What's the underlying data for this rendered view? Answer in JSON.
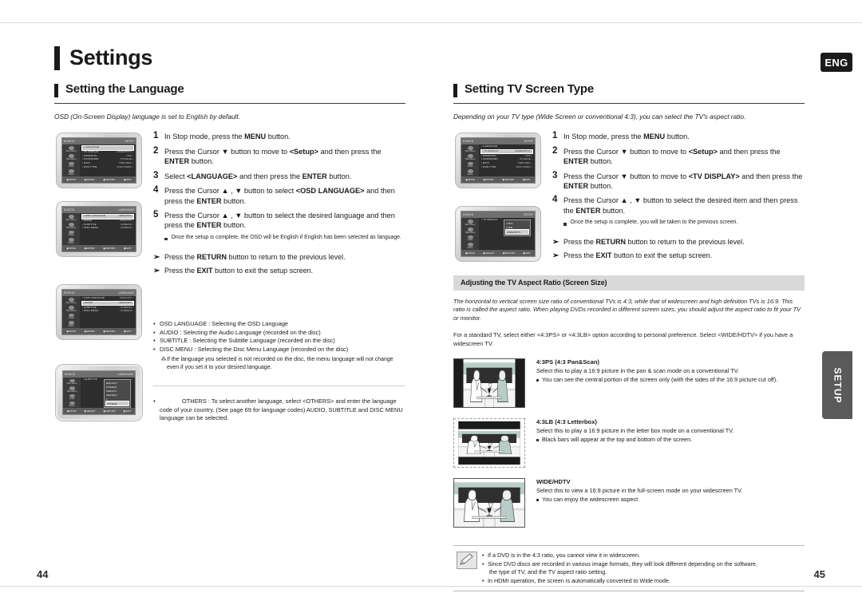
{
  "document": {
    "chapter_title": "Settings",
    "language_tab": "ENG",
    "side_tab": "SETUP",
    "page_left": "44",
    "page_right": "45"
  },
  "left_page": {
    "section_title": "Setting the Language",
    "intro": "OSD  (On-Screen Display) language is set to English by default.",
    "steps": [
      {
        "num": "1",
        "html": "In Stop mode, press the <b>MENU</b> button."
      },
      {
        "num": "2",
        "html": "Press the Cursor ▼ button to move to <b>&lt;Setup&gt;</b> and then press the <b>ENTER</b> button."
      },
      {
        "num": "3",
        "html": "Select <b>&lt;LANGUAGE&gt;</b> and then press the <b>ENTER</b> button."
      },
      {
        "num": "4",
        "html": "Press the Cursor ▲ , ▼ button to select <b>&lt;OSD LANGUAGE&gt;</b> and then press the <b>ENTER</b> button."
      },
      {
        "num": "5",
        "html": "Press the Cursor ▲ , ▼ button to select the desired language and then press the <b>ENTER</b> button."
      }
    ],
    "substep": "Once the setup is complete, the OSD will be English if English has been selected as language.",
    "arrow_notes": [
      "Press the <b>RETURN</b> button to return to the previous level.",
      "Press the <b>EXIT</b> button to exit the setup screen."
    ],
    "bullets": [
      "OSD LANGUAGE : Selecting the OSD Language",
      "AUDIO : Selecting the Audio Language (recorded on the disc)",
      "SUBTITLE : Selecting the Subtitle Language (recorded on the disc)",
      "DISC MENU : Selecting the Disc Menu Language (recorded on the disc)"
    ],
    "bullets_note": "If the language you selected is not recorded on the disc, the menu language will not change even if you set it to your desired language.",
    "others_label": "OTHERS : ",
    "others_text": "To select another language, select <OTHERS> and enter the language code of your country. (See page 69 for language codes) AUDIO, SUBTITLE and DISC MENU language can be selected.",
    "screens": [
      {
        "title_left": "DVD/CD",
        "title_right": "SETUP",
        "side": [
          "Disc Menu",
          "Title Menu",
          "Audio",
          "Setup"
        ],
        "rows": [
          {
            "label": "LANGUAGE",
            "value": "",
            "hl": true
          },
          {
            "label": "TV DISPLAY",
            "value": "WIDE/HDTV",
            "hl": false
          },
          {
            "label": "PARENTAL",
            "value": "OFF",
            "hl": false
          },
          {
            "label": "PASSWORD",
            "value": "CHANGE",
            "hl": false
          },
          {
            "label": "DIVX",
            "value": "ORIGINAL",
            "hl": false
          },
          {
            "label": "DVD TYPE",
            "value": "DVD AUDIO",
            "hl": false
          }
        ],
        "footer": [
          "MOVE",
          "ENTER",
          "RETURN",
          "EXIT"
        ]
      },
      {
        "title_left": "DVD/CD",
        "title_right": "LANGUAGE",
        "side": [
          "Disc Menu",
          "Title Menu",
          "Audio",
          "Setup"
        ],
        "rows": [
          {
            "label": "OSD LANGUAGE",
            "value": "ENGLISH",
            "hl": true
          },
          {
            "label": "AUDIO",
            "value": "ENGLISH",
            "hl": false
          },
          {
            "label": "SUBTITLE",
            "value": "KOREAN",
            "hl": false
          },
          {
            "label": "DISC MENU",
            "value": "KOREAN",
            "hl": false
          }
        ],
        "footer": [
          "MOVE",
          "ENTER",
          "RETURN",
          "EXIT"
        ]
      },
      {
        "title_left": "DVD/CD",
        "title_right": "LANGUAGE",
        "side": [
          "Disc Menu",
          "Title Menu",
          "Audio",
          "Setup"
        ],
        "rows": [
          {
            "label": "OSD LANGUAGE",
            "value": "ENGLISH",
            "hl": false
          },
          {
            "label": "AUDIO",
            "value": "ENGLISH",
            "hl": true
          },
          {
            "label": "SUBTITLE",
            "value": "KOREAN",
            "hl": false
          },
          {
            "label": "DISC MENU",
            "value": "KOREAN",
            "hl": false
          }
        ],
        "footer": [
          "MOVE",
          "ENTER",
          "RETURN",
          "EXIT"
        ]
      },
      {
        "title_left": "DVD/CD",
        "title_right": "LANGUAGE",
        "side": [
          "Disc Menu",
          "Title Menu",
          "Audio",
          "Setup"
        ],
        "rows": [
          {
            "label": "SUBTITLE",
            "value": "",
            "hl": false
          }
        ],
        "popup": [
          "ENGLISH",
          "KOREAN",
          "FRENCH",
          "GERMAN",
          "▾",
          "OTHERS"
        ],
        "popup_hl": "OTHERS",
        "footer": [
          "MOVE",
          "SELECT",
          "RETURN",
          "EXIT"
        ]
      }
    ]
  },
  "right_page": {
    "section_title": "Setting TV Screen Type",
    "intro": "Depending on your TV type (Wide Screen or conventional 4:3), you can select the TV's aspect ratio.",
    "steps": [
      {
        "num": "1",
        "html": "In Stop mode, press the <b>MENU</b> button."
      },
      {
        "num": "2",
        "html": "Press the Cursor ▼ button to move to <b>&lt;Setup&gt;</b> and then press the <b>ENTER</b> button."
      },
      {
        "num": "3",
        "html": "Press the Cursor ▼ button to move to <b>&lt;TV DISPLAY&gt;</b> and then press the <b>ENTER</b> button."
      },
      {
        "num": "4",
        "html": "Press the Cursor ▲ , ▼ button to select the desired item and then press the <b>ENTER</b> button."
      }
    ],
    "substep": "Once the setup is complete, you will be taken to the previous screen.",
    "arrow_notes": [
      "Press the <b>RETURN</b> button to return to the previous level.",
      "Press the <b>EXIT</b> button to exit the setup screen."
    ],
    "band_title": "Adjusting the TV Aspect Ratio (Screen Size)",
    "para_italic": "The horizontal to vertical screen size ratio of conventional TVs is 4:3, while that of widescreen and high definition TVs is 16:9. This ratio is called the aspect ratio. When playing DVDs recorded in different screen sizes, you should adjust the aspect ratio to fit your TV or monitor.",
    "para_plain": "For a standard TV, select either <4:3PS> or <4:3LB> option according to personal preference. Select <WIDE/HDTV> if you have a widescreen TV.",
    "aspect_blocks": [
      {
        "title": "4:3PS (4:3 Pan&Scan)",
        "desc": "Select this to play a 16:9 picture in the pan & scan mode on a conventional TV.",
        "sub": "You can see the central portion of the screen only (with the sides of the 16:9 picture cut off).",
        "style": "panscan"
      },
      {
        "title": "4:3LB (4:3 Letterbox)",
        "desc": "Select this to play a 16:9 picture in the letter box mode on a conventional TV.",
        "sub": "Black bars will appear at the top and bottom of the screen.",
        "style": "letterbox"
      },
      {
        "title": "WIDE/HDTV",
        "desc": "Select this to view a 16:9 picture in the full-screen mode on your widescreen TV.",
        "sub": "You can enjoy the widescreen aspect.",
        "style": "wide"
      }
    ],
    "notes": [
      {
        "text": "If a DVD is in the 4:3 ratio, you cannot view it in widescreen.",
        "cont": ""
      },
      {
        "text": "Since DVD discs are recorded in various image formats, they will look different depending on the software,",
        "cont": "the type of TV, and the TV aspect ratio setting."
      },
      {
        "text": "In HDMI operation, the screen is automatically converted to Wide mode.",
        "cont": ""
      }
    ],
    "screens": [
      {
        "title_left": "DVD/CD",
        "title_right": "SETUP",
        "side": [
          "Disc Menu",
          "Title Menu",
          "Audio",
          "Setup"
        ],
        "rows": [
          {
            "label": "LANGUAGE",
            "value": "",
            "hl": false
          },
          {
            "label": "TV DISPLAY",
            "value": "WIDE/HDTV",
            "hl": true
          },
          {
            "label": "PARENTAL",
            "value": "OFF",
            "hl": false
          },
          {
            "label": "PASSWORD",
            "value": "CHANGE",
            "hl": false
          },
          {
            "label": "DIVX",
            "value": "ORIGINAL",
            "hl": false
          },
          {
            "label": "DVD TYPE",
            "value": "DVD AUDIO",
            "hl": false
          }
        ],
        "footer": [
          "MOVE",
          "ENTER",
          "RETURN",
          "EXIT"
        ]
      },
      {
        "title_left": "DVD/CD",
        "title_right": "SETUP",
        "side": [
          "Disc Menu",
          "Title Menu",
          "Audio",
          "Setup"
        ],
        "rows": [
          {
            "label": "TV DISPLAY",
            "value": "",
            "hl": false
          }
        ],
        "popup": [
          "4:3PS",
          "4:3LB",
          "WIDE/HDTV"
        ],
        "popup_hl": "WIDE/HDTV",
        "footer": [
          "MOVE",
          "SELECT",
          "RETURN",
          "EXIT"
        ]
      }
    ]
  }
}
